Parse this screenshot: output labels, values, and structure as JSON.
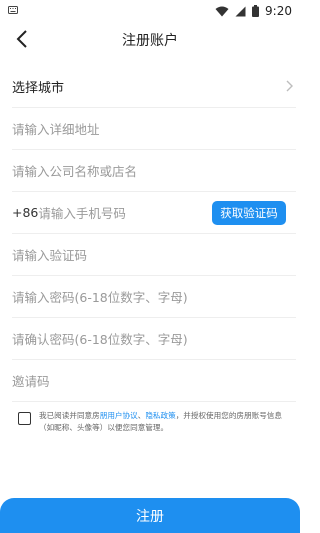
{
  "status_bar": {
    "time": "9:20"
  },
  "header": {
    "title": "注册账户"
  },
  "form": {
    "city": {
      "label": "选择城市"
    },
    "address": {
      "placeholder": "请输入详细地址"
    },
    "company": {
      "placeholder": "请输入公司名称或店名"
    },
    "phone": {
      "prefix": "+86",
      "placeholder": "请输入手机号码",
      "code_button": "获取验证码"
    },
    "verify_code": {
      "placeholder": "请输入验证码"
    },
    "password": {
      "placeholder": "请输入密码(6-18位数字、字母)"
    },
    "confirm_password": {
      "placeholder": "请确认密码(6-18位数字、字母)"
    },
    "invite_code": {
      "placeholder": "邀请码"
    }
  },
  "agreement": {
    "text_1": "我已阅读并同意房",
    "link_1": "朋用户协议",
    "sep": "、",
    "link_2": "隐私政策",
    "text_2": "，并授权使用您的房朋账号信息（如昵称、头像等）以便您同意管理。"
  },
  "register_button": "注册",
  "colors": {
    "accent": "#1e8ff0"
  }
}
